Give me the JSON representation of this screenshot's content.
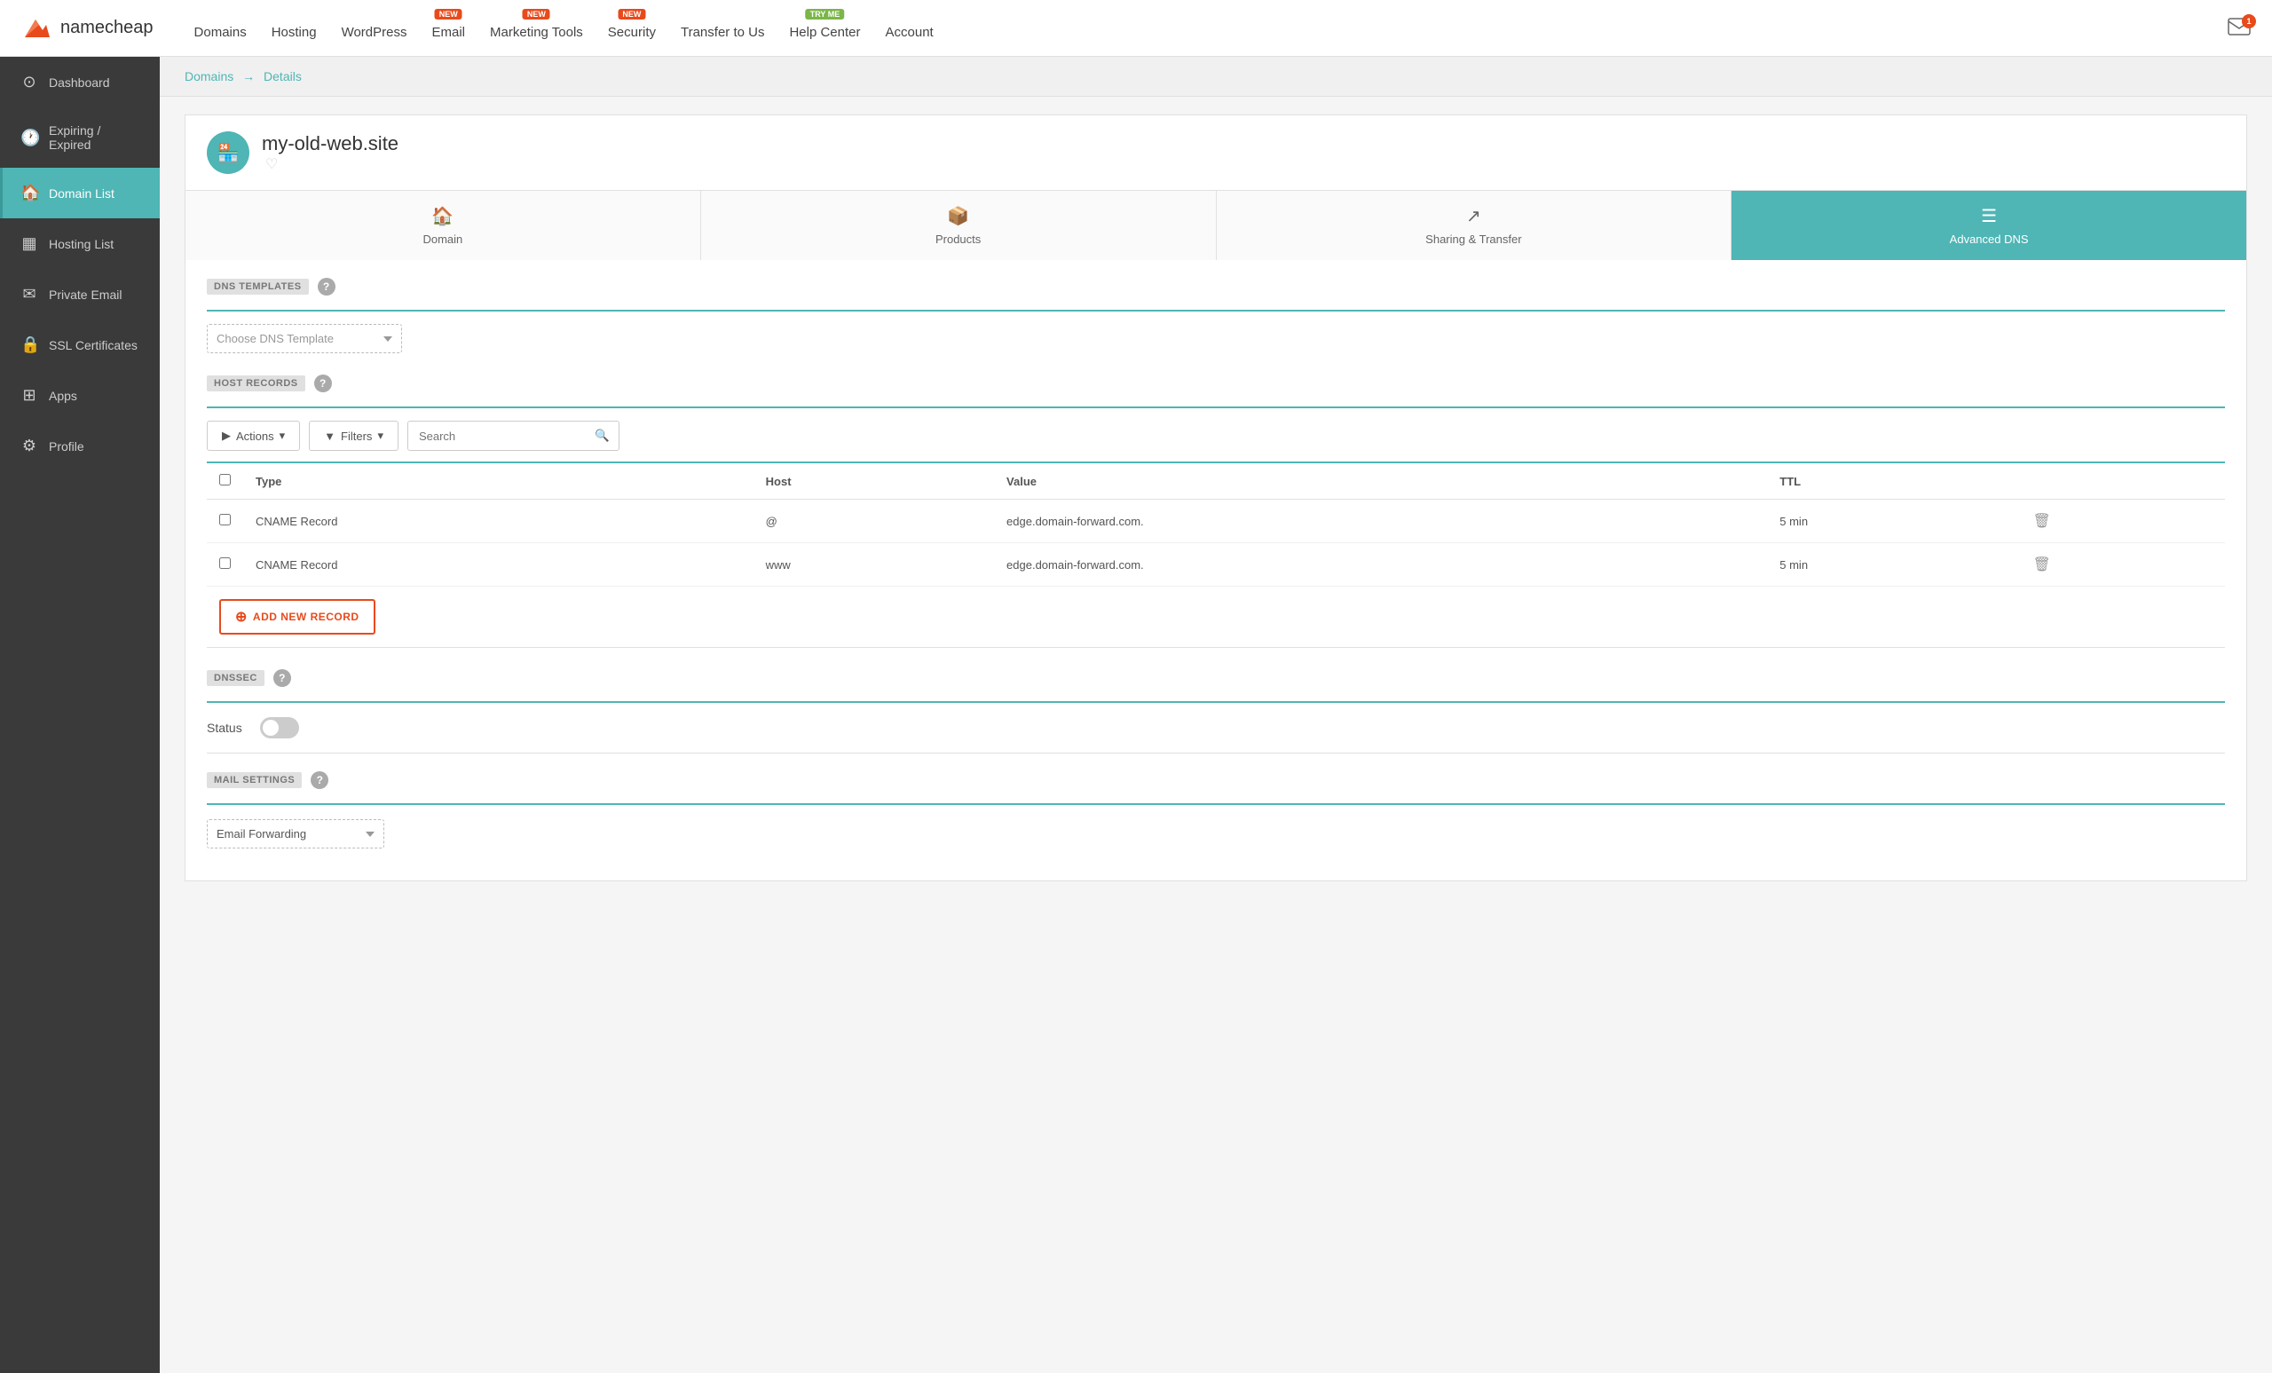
{
  "brand": {
    "logo_text": "namecheap",
    "logo_letter": "N"
  },
  "top_nav": {
    "items": [
      {
        "label": "Domains",
        "badge": null
      },
      {
        "label": "Hosting",
        "badge": null
      },
      {
        "label": "WordPress",
        "badge": null
      },
      {
        "label": "Email",
        "badge": "NEW"
      },
      {
        "label": "Marketing Tools",
        "badge": "NEW"
      },
      {
        "label": "Security",
        "badge": "NEW"
      },
      {
        "label": "Transfer to Us",
        "badge": null
      },
      {
        "label": "Help Center",
        "badge": "TRY ME"
      },
      {
        "label": "Account",
        "badge": null
      }
    ],
    "mail_count": "1"
  },
  "sidebar": {
    "items": [
      {
        "label": "Dashboard",
        "icon": "⊙",
        "active": false
      },
      {
        "label": "Expiring / Expired",
        "icon": "🕐",
        "active": false
      },
      {
        "label": "Domain List",
        "icon": "🏠",
        "active": true
      },
      {
        "label": "Hosting List",
        "icon": "⊟",
        "active": false
      },
      {
        "label": "Private Email",
        "icon": "✉",
        "active": false
      },
      {
        "label": "SSL Certificates",
        "icon": "🔒",
        "active": false
      },
      {
        "label": "Apps",
        "icon": "⊞",
        "active": false
      },
      {
        "label": "Profile",
        "icon": "⚙",
        "active": false
      }
    ]
  },
  "breadcrumb": {
    "root": "Domains",
    "arrow": "→",
    "current": "Details"
  },
  "domain": {
    "name": "my-old-web.site",
    "avatar_icon": "🏪"
  },
  "tabs": [
    {
      "label": "Domain",
      "icon": "🏠",
      "active": false
    },
    {
      "label": "Products",
      "icon": "📦",
      "active": false
    },
    {
      "label": "Sharing & Transfer",
      "icon": "↗",
      "active": false
    },
    {
      "label": "Advanced DNS",
      "icon": "☰",
      "active": true
    }
  ],
  "dns_templates": {
    "section_label": "DNS TEMPLATES",
    "placeholder": "Choose DNS Template"
  },
  "host_records": {
    "section_label": "HOST RECORDS",
    "actions_label": "Actions",
    "filters_label": "Filters",
    "search_placeholder": "Search",
    "columns": [
      "Type",
      "Host",
      "Value",
      "TTL"
    ],
    "records": [
      {
        "type": "CNAME Record",
        "host": "@",
        "value": "edge.domain-forward.com.",
        "ttl": "5 min"
      },
      {
        "type": "CNAME Record",
        "host": "www",
        "value": "edge.domain-forward.com.",
        "ttl": "5 min"
      }
    ],
    "add_record_label": "ADD NEW RECORD"
  },
  "dnssec": {
    "section_label": "DNSSEC",
    "status_label": "Status"
  },
  "mail_settings": {
    "section_label": "MAIL SETTINGS",
    "value": "Email Forwarding"
  }
}
